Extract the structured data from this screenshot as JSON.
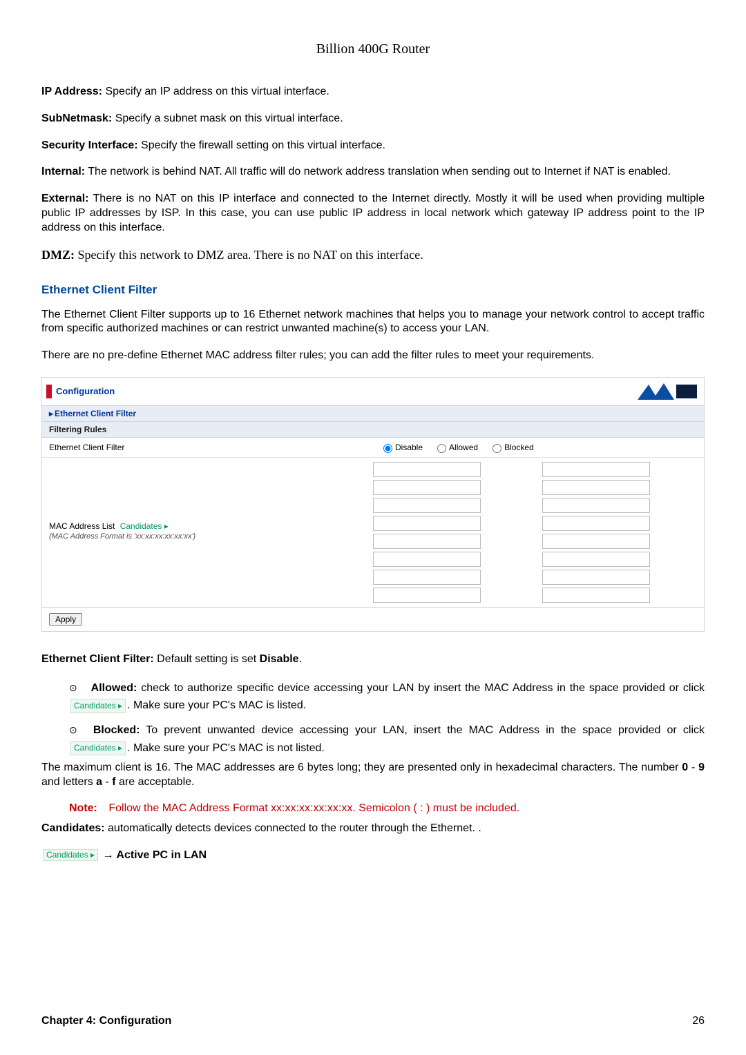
{
  "header": {
    "title": "Billion 400G Router"
  },
  "paras": {
    "ip": {
      "label": "IP Address:",
      "text": " Specify an IP address on this virtual interface."
    },
    "sub": {
      "label": "SubNetmask:",
      "text": " Specify a subnet mask on this virtual interface."
    },
    "sec": {
      "label": "Security Interface:",
      "text": " Specify the firewall setting on this virtual interface."
    },
    "int": {
      "label": "Internal:",
      "text": " The network is behind NAT. All traffic will do network address translation when sending out to Internet if NAT is enabled."
    },
    "ext": {
      "label": "External:",
      "text": " There is no NAT on this IP interface and connected to the Internet directly. Mostly it will be used when providing multiple public IP addresses by ISP. In this case, you can use public IP address in local network which gateway IP address point to the IP address on this interface."
    },
    "dmz": {
      "label": "DMZ:",
      "text": " Specify this network to DMZ area. There is no NAT on this interface."
    }
  },
  "section": {
    "heading": "Ethernet Client Filter",
    "p1": "The Ethernet Client Filter supports up to 16 Ethernet network machines that helps you to manage your network control to accept traffic from specific authorized machines or can restrict unwanted machine(s) to access your LAN.",
    "p2": "There are no pre-define Ethernet MAC address filter rules; you can add the filter rules to meet your requirements."
  },
  "panel": {
    "title": "Configuration",
    "subhead": "Ethernet Client Filter",
    "rules": "Filtering Rules",
    "row1_label": "Ethernet Client Filter",
    "radios": {
      "disable": "Disable",
      "allowed": "Allowed",
      "blocked": "Blocked"
    },
    "mac_label": "MAC Address List",
    "candidates": "Candidates ▸",
    "mac_format": "(MAC Address Format is 'xx:xx:xx:xx:xx:xx')",
    "apply": "Apply",
    "mac_count": 16
  },
  "below": {
    "ecf_label": "Ethernet Client Filter:",
    "ecf_text": " Default setting is set ",
    "ecf_bold": "Disable",
    "allowed_label": "Allowed:",
    "allowed_text": " check to authorize specific device accessing your LAN by insert the MAC Address in the space provided or click ",
    "allowed_tail_a": ".   Make sure your PC's MAC is listed.",
    "blocked_label": "Blocked:",
    "blocked_text_a": " To  prevent  unwanted  device  accessing  your  LAN,  insert  the  MAC  Address  in the space provided or click  ",
    "blocked_tail": ". Make sure your PC's MAC is not listed.",
    "max_a": "The maximum client is 16.  The MAC addresses are 6 bytes long; they are presented only in hexadecimal characters.    The number ",
    "max_09": "0",
    "dash1": " - ",
    "max_9": "9",
    "max_mid": " and letters ",
    "max_a2": "a",
    "dash2": " - ",
    "max_f": "f",
    "max_tail": " are acceptable.",
    "note_label": "Note:",
    "note_text": "Follow the MAC Address Format xx:xx:xx:xx:xx:xx.   Semicolon ( : ) must be included.",
    "cand_label": "Candidates:",
    "cand_text": " automatically detects devices connected to the router through the Ethernet. .",
    "arrow_text": "→ Active PC in LAN",
    "inline_candidates": "Candidates ▸"
  },
  "footer": {
    "left": "Chapter 4: Configuration",
    "right": "26"
  }
}
